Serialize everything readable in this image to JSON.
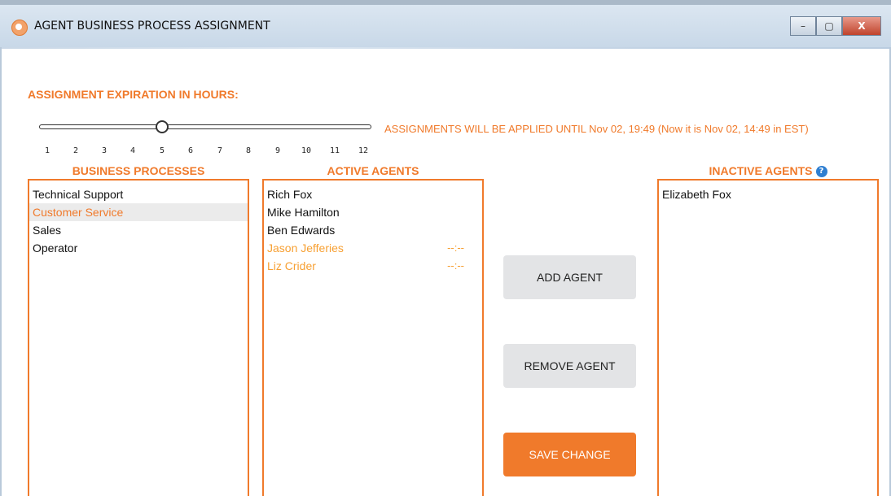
{
  "window": {
    "title": "AGENT BUSINESS PROCESS ASSIGNMENT",
    "controls": {
      "minimize": "–",
      "maximize": "▢",
      "close": "X"
    }
  },
  "expiration": {
    "heading": "ASSIGNMENT EXPIRATION IN HOURS:",
    "selected_hours": 5,
    "ticks": [
      "1",
      "2",
      "3",
      "4",
      "5",
      "6",
      "7",
      "8",
      "9",
      "10",
      "11",
      "12"
    ],
    "note": "ASSIGNMENTS WILL BE APPLIED UNTIL Nov 02, 19:49 (Now it is Nov 02, 14:49 in EST)"
  },
  "business_processes": {
    "heading": "BUSINESS PROCESSES",
    "items": [
      "Technical Support",
      "Customer Service",
      "Sales",
      "Operator"
    ],
    "selected": "Customer Service"
  },
  "active_agents": {
    "heading": "ACTIVE AGENTS",
    "items": [
      {
        "name": "Rich Fox",
        "time": ""
      },
      {
        "name": "Mike Hamilton",
        "time": ""
      },
      {
        "name": "Ben Edwards",
        "time": ""
      },
      {
        "name": "Jason Jefferies",
        "time": "--:--"
      },
      {
        "name": "Liz Crider",
        "time": "--:--"
      }
    ]
  },
  "inactive_agents": {
    "heading": "INACTIVE AGENTS",
    "help": "?",
    "items": [
      "Elizabeth Fox"
    ]
  },
  "buttons": {
    "add": "ADD AGENT",
    "remove": "REMOVE AGENT",
    "save": "SAVE CHANGE"
  },
  "colors": {
    "accent": "#f07a2b",
    "pending": "#f7a033",
    "button_grey": "#e3e4e6"
  }
}
